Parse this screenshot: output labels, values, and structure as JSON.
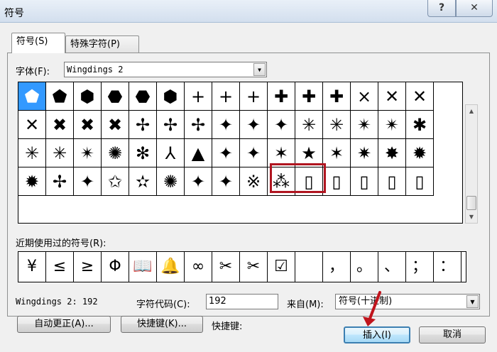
{
  "window": {
    "title": "符号",
    "help": "?",
    "close": "✕"
  },
  "tabs": [
    {
      "label": "符号(S)"
    },
    {
      "label": "特殊字符(P)"
    }
  ],
  "font": {
    "label": "字体(F):",
    "value": "Wingdings 2"
  },
  "symbol_rows": [
    [
      "⬟",
      "⬟",
      "⬢",
      "⬣",
      "⬣",
      "⬢",
      "+",
      "+",
      "+",
      "✚",
      "✚",
      "✚",
      "×",
      "✕",
      "✕"
    ],
    [
      "✕",
      "✖",
      "✖",
      "✖",
      "✢",
      "✢",
      "✢",
      "✦",
      "✦",
      "✦",
      "✳",
      "✳",
      "✴",
      "✴",
      "✱"
    ],
    [
      "✳",
      "✳",
      "✴",
      "✺",
      "✻",
      "⅄",
      "▲",
      "✦",
      "✦",
      "✶",
      "★",
      "✶",
      "✷",
      "✸",
      "✹"
    ],
    [
      "✹",
      "✢",
      "✦",
      "✩",
      "✫",
      "✺",
      "✦",
      "✦",
      "※",
      "⁂",
      "▯",
      "▯",
      "▯",
      "▯",
      "▯"
    ]
  ],
  "recent": {
    "label": "近期使用过的符号(R):",
    "symbols": [
      "¥",
      "≤",
      "≥",
      "Φ",
      "📖",
      "🔔",
      "∞",
      "✂",
      "✂",
      "☑",
      "",
      "，",
      "。",
      "、",
      "；",
      "："
    ]
  },
  "status": {
    "font_code": "Wingdings 2: 192",
    "code_label": "字符代码(C):",
    "code_value": "192",
    "from_label": "来自(M):",
    "from_value": "符号(十进制)"
  },
  "buttons": {
    "autocorrect": "自动更正(A)...",
    "shortcut": "快捷键(K)...",
    "shortcut_label": "快捷键:",
    "insert": "插入(I)",
    "cancel": "取消"
  },
  "colors": {
    "selected_cell": "#3399ff",
    "highlight_box": "#b01520",
    "arrow": "#c0141c"
  }
}
